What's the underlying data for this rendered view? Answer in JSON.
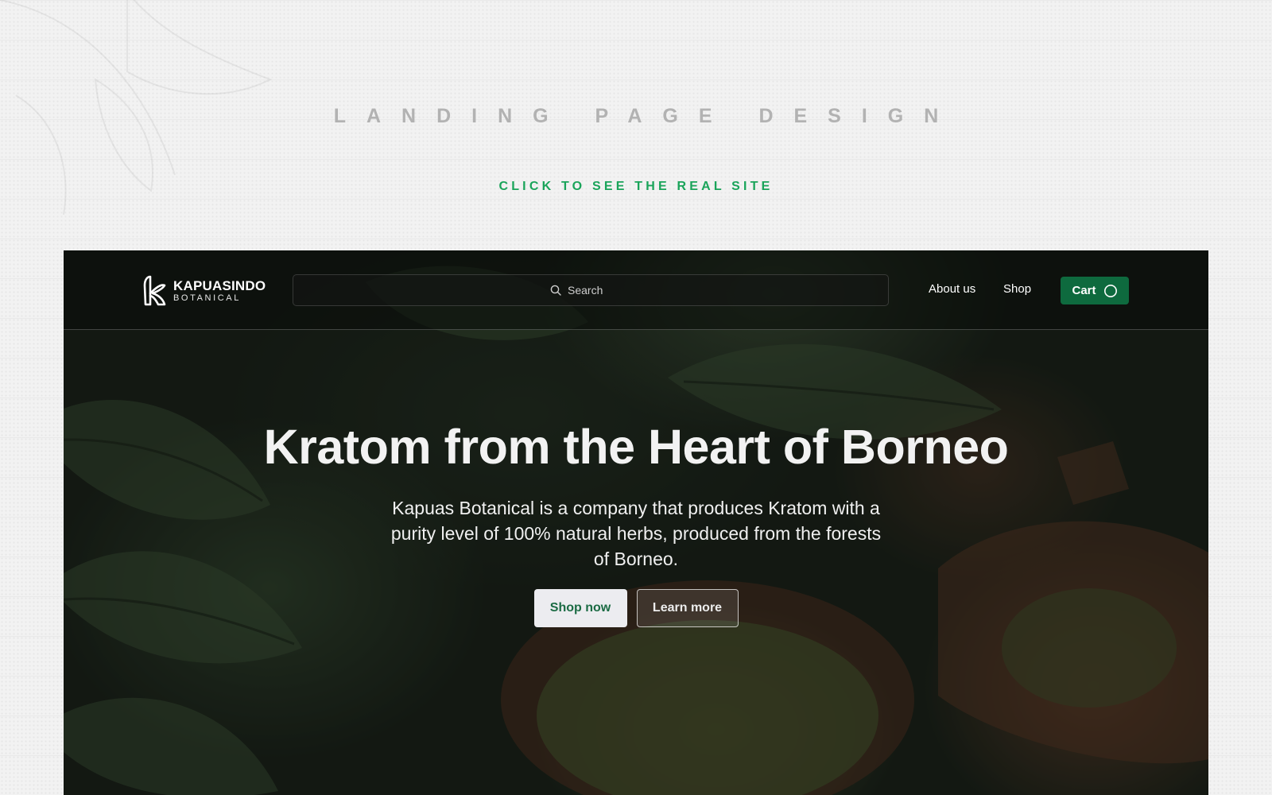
{
  "page": {
    "heading": "LANDING PAGE DESIGN",
    "cta_link": "CLICK TO SEE THE REAL SITE"
  },
  "header": {
    "logo": {
      "name": "KAPUASINDO",
      "sub": "BOTANICAL"
    },
    "search": {
      "placeholder": "Search"
    },
    "nav": {
      "about": "About us",
      "shop": "Shop",
      "cart": "Cart"
    }
  },
  "hero": {
    "title": "Kratom from the Heart of Borneo",
    "subtitle": "Kapuas Botanical is a company that produces Kratom with a purity level of 100% natural herbs, produced from the forests of Borneo.",
    "primary_button": "Shop now",
    "secondary_button": "Learn more"
  },
  "colors": {
    "accent_green": "#1aa45a",
    "cart_green": "#0e6a3e",
    "heading_gray": "#b2b2b2"
  },
  "icons": {
    "search": "search-icon",
    "cart": "cart-icon",
    "logo": "logo-icon"
  }
}
